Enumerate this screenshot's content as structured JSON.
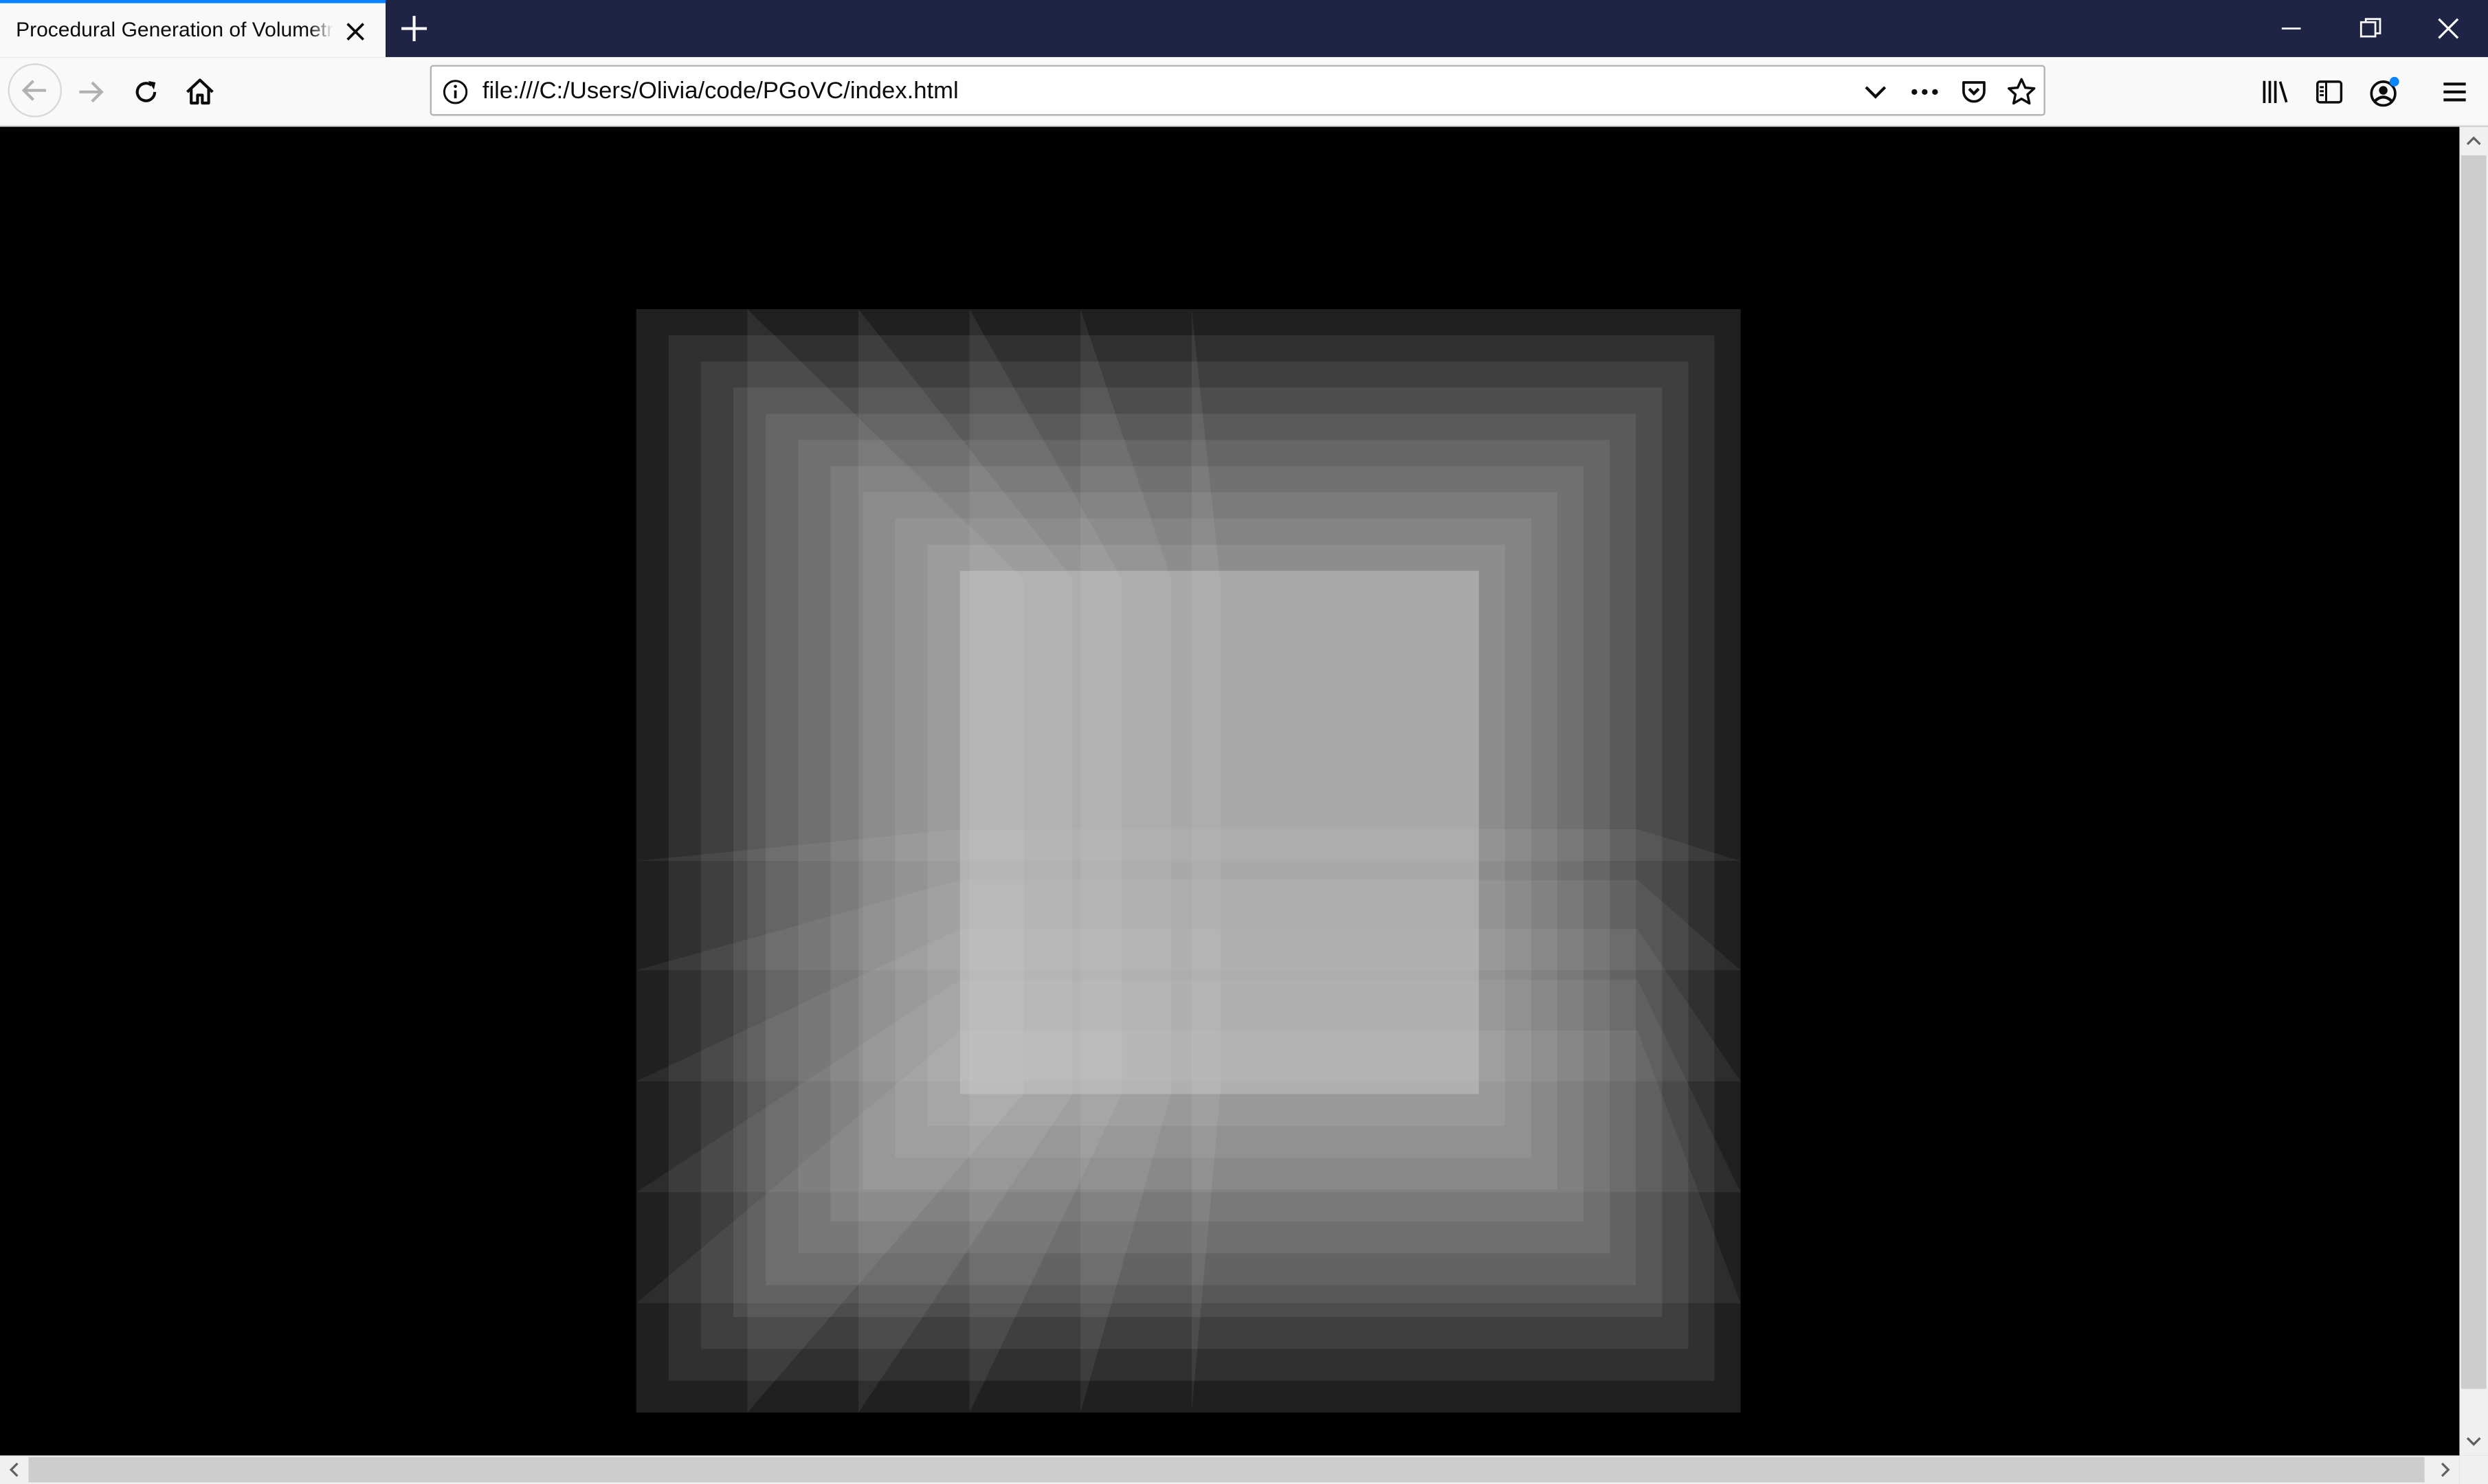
{
  "browser": {
    "tab": {
      "title": "Procedural Generation of Volumetric Clouds",
      "active": true
    },
    "url": "file:///C:/Users/Olivia/code/PGoVC/index.html",
    "colors": {
      "titlebar": "#1f2344",
      "tab_accent": "#0a84ff",
      "toolbar": "#f9f9fa",
      "notification_dot": "#0a84ff"
    },
    "icons": {
      "tab_close": "close-icon",
      "new_tab": "plus-icon",
      "minimize": "minimize-icon",
      "restore": "restore-icon",
      "close_window": "close-window-icon",
      "back": "back-arrow-icon",
      "forward": "forward-arrow-icon",
      "reload": "reload-icon",
      "home": "home-icon",
      "site_info": "info-icon",
      "url_dropdown": "chevron-down-icon",
      "page_actions": "more-icon",
      "pocket": "pocket-icon",
      "bookmark": "star-icon",
      "library": "library-icon",
      "sidebars": "sidebar-icon",
      "account": "account-icon",
      "menu": "hamburger-icon"
    }
  },
  "content": {
    "background": "#000000",
    "render": "volumetric slice stack"
  }
}
